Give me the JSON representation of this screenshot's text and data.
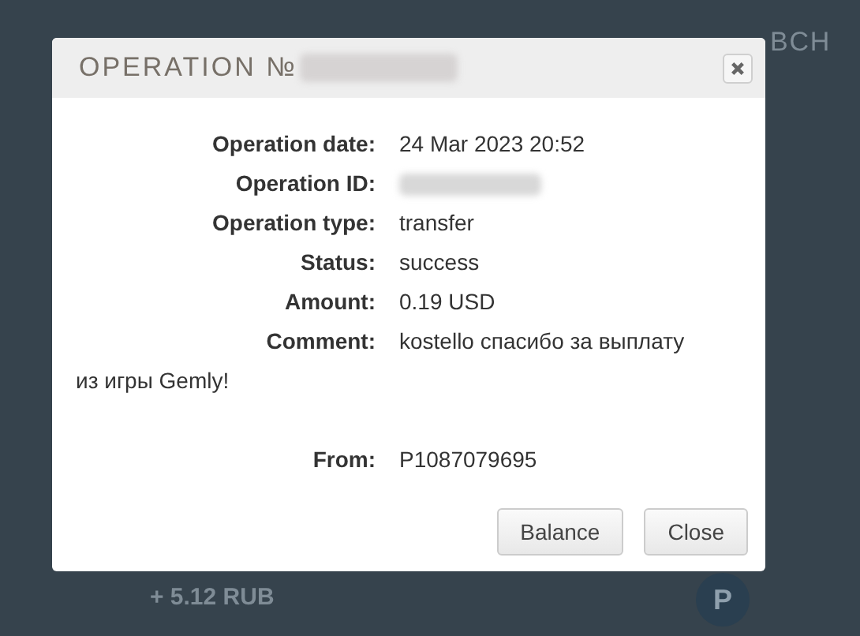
{
  "background": {
    "tab": "BCH",
    "amount": "+ 5.12 RUB",
    "badge": "P"
  },
  "dialog": {
    "title": "OPERATION №",
    "redacted_title_id": true,
    "fields": [
      {
        "kind": "plain",
        "label": "Operation date:",
        "value": "24 Mar 2023 20:52"
      },
      {
        "kind": "redacted",
        "label": "Operation ID:"
      },
      {
        "kind": "plain",
        "label": "Operation type:",
        "value": "transfer"
      },
      {
        "kind": "plain",
        "label": "Status:",
        "value": "success"
      },
      {
        "kind": "plain",
        "label": "Amount:",
        "value": "0.19 USD"
      },
      {
        "kind": "note",
        "label": "Comment:",
        "value": "kostello спасибо за выплату из игры Gemly!"
      },
      {
        "kind": "plain",
        "label": "From:",
        "value": "P1087079695"
      }
    ],
    "buttons": [
      "Balance",
      "Close"
    ]
  }
}
